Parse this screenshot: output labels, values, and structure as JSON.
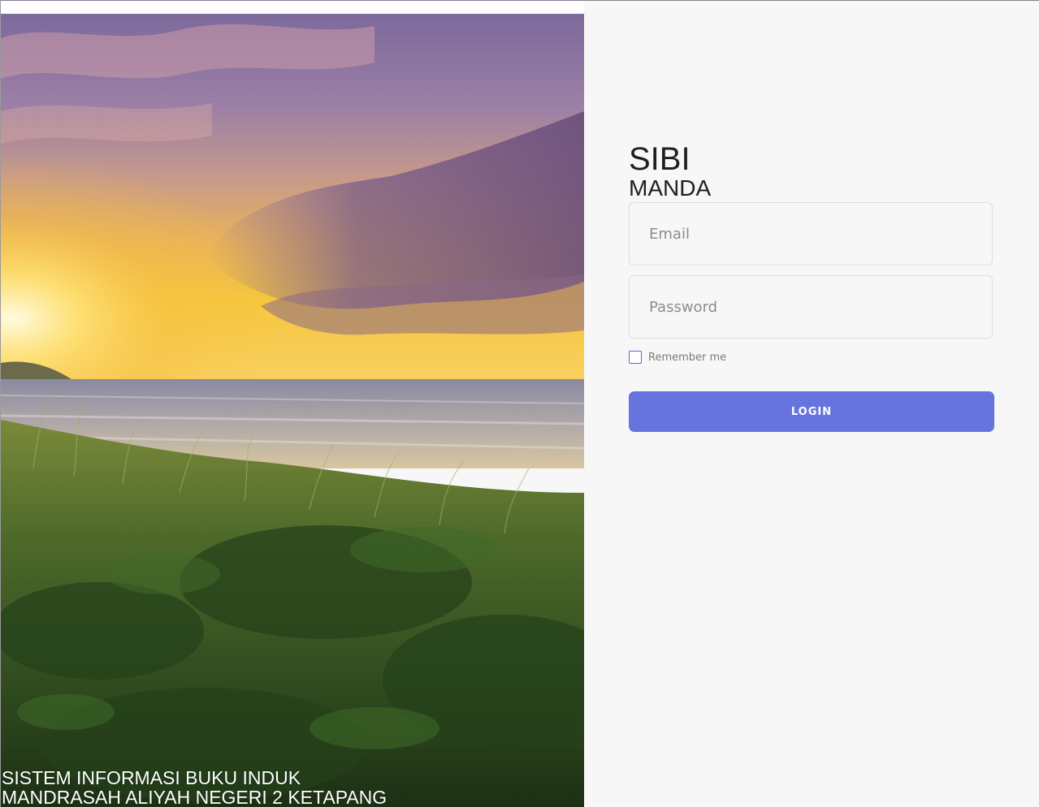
{
  "hero": {
    "image": "sunset-beach-grass-photo",
    "caption_line1": "SISTEM INFORMASI BUKU INDUK",
    "caption_line2": "MANDRASAH ALIYAH NEGERI 2 KETAPANG"
  },
  "brand": {
    "title": "SIBI",
    "subtitle": "MANDA"
  },
  "form": {
    "email_placeholder": "Email",
    "password_placeholder": "Password",
    "remember_label": "Remember me",
    "remember_checked": false,
    "login_label": "LOGIN"
  },
  "colors": {
    "accent": "#6675de",
    "panel_bg": "#f7f7f7",
    "text_dark": "#1f1f1f"
  }
}
